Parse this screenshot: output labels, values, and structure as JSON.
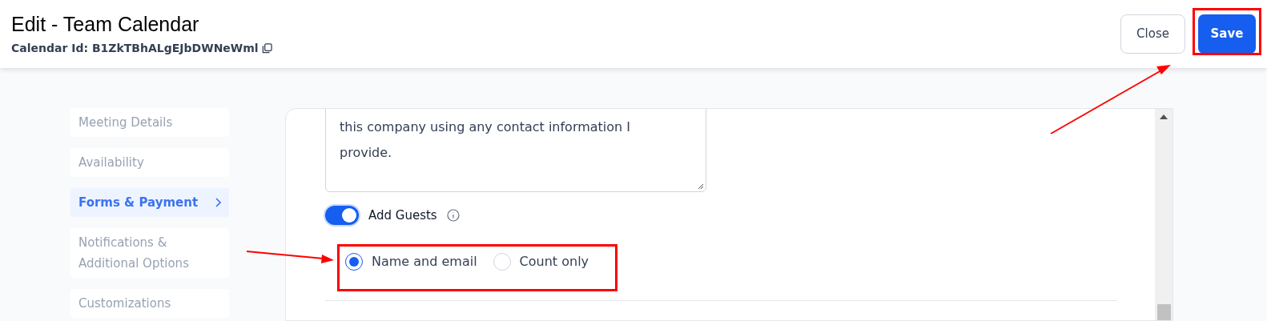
{
  "header": {
    "title": "Edit - Team Calendar",
    "calendar_id": "Calendar Id: B1ZkTBhALgEJbDWNeWml",
    "buttons": [
      {
        "label": "Close",
        "kind": "secondary"
      },
      {
        "label": "Save",
        "kind": "primary"
      }
    ]
  },
  "sidebar": {
    "items": [
      {
        "label": "Meeting Details",
        "selected": false
      },
      {
        "label": "Availability",
        "selected": false
      },
      {
        "label": "Forms & Payment",
        "selected": true
      },
      {
        "label": "Notifications & Additional Options",
        "selected": false
      },
      {
        "label": "Customizations",
        "selected": false
      }
    ]
  },
  "form": {
    "consent_text": "this company using any contact information I\nprovide.",
    "add_guests": {
      "label": "Add Guests",
      "on": true
    },
    "guest_options": [
      {
        "label": "Name and email",
        "selected": true
      },
      {
        "label": "Count only",
        "selected": false
      }
    ]
  }
}
